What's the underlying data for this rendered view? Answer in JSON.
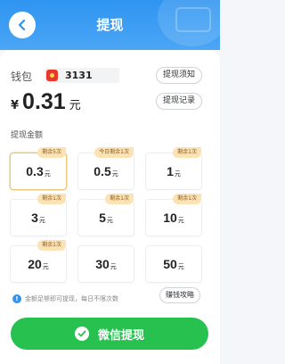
{
  "header": {
    "title": "提现"
  },
  "wallet": {
    "label": "钱包",
    "id": "3131"
  },
  "balance": {
    "currency": "¥",
    "amount": "0.31",
    "unit": "元"
  },
  "actions": {
    "notice": "提现须知",
    "records": "提现记录"
  },
  "amount_section": {
    "label": "提现金额"
  },
  "options": [
    {
      "amount": "0.3",
      "unit": "元",
      "tag": "剩余5次",
      "selected": true
    },
    {
      "amount": "0.5",
      "unit": "元",
      "tag": "今日剩余1次",
      "selected": false
    },
    {
      "amount": "1",
      "unit": "元",
      "tag": "剩余1次",
      "selected": false
    },
    {
      "amount": "3",
      "unit": "元",
      "tag": "剩余1次",
      "selected": false
    },
    {
      "amount": "5",
      "unit": "元",
      "tag": "剩余1次",
      "selected": false
    },
    {
      "amount": "10",
      "unit": "元",
      "tag": "剩余1次",
      "selected": false
    },
    {
      "amount": "20",
      "unit": "元",
      "tag": "剩余1次",
      "selected": false
    },
    {
      "amount": "30",
      "unit": "元",
      "tag": "",
      "selected": false
    },
    {
      "amount": "50",
      "unit": "元",
      "tag": "",
      "selected": false
    }
  ],
  "note": {
    "text": "金额足够即可提现，每日不限次数"
  },
  "strategy": {
    "label": "赚钱攻略"
  },
  "submit": {
    "label": "微信提现"
  },
  "colors": {
    "primary": "#2f94f1",
    "wechat_green": "#27c14f",
    "tag_bg": "#fbe3b6",
    "selected_border": "#e9c97b"
  }
}
